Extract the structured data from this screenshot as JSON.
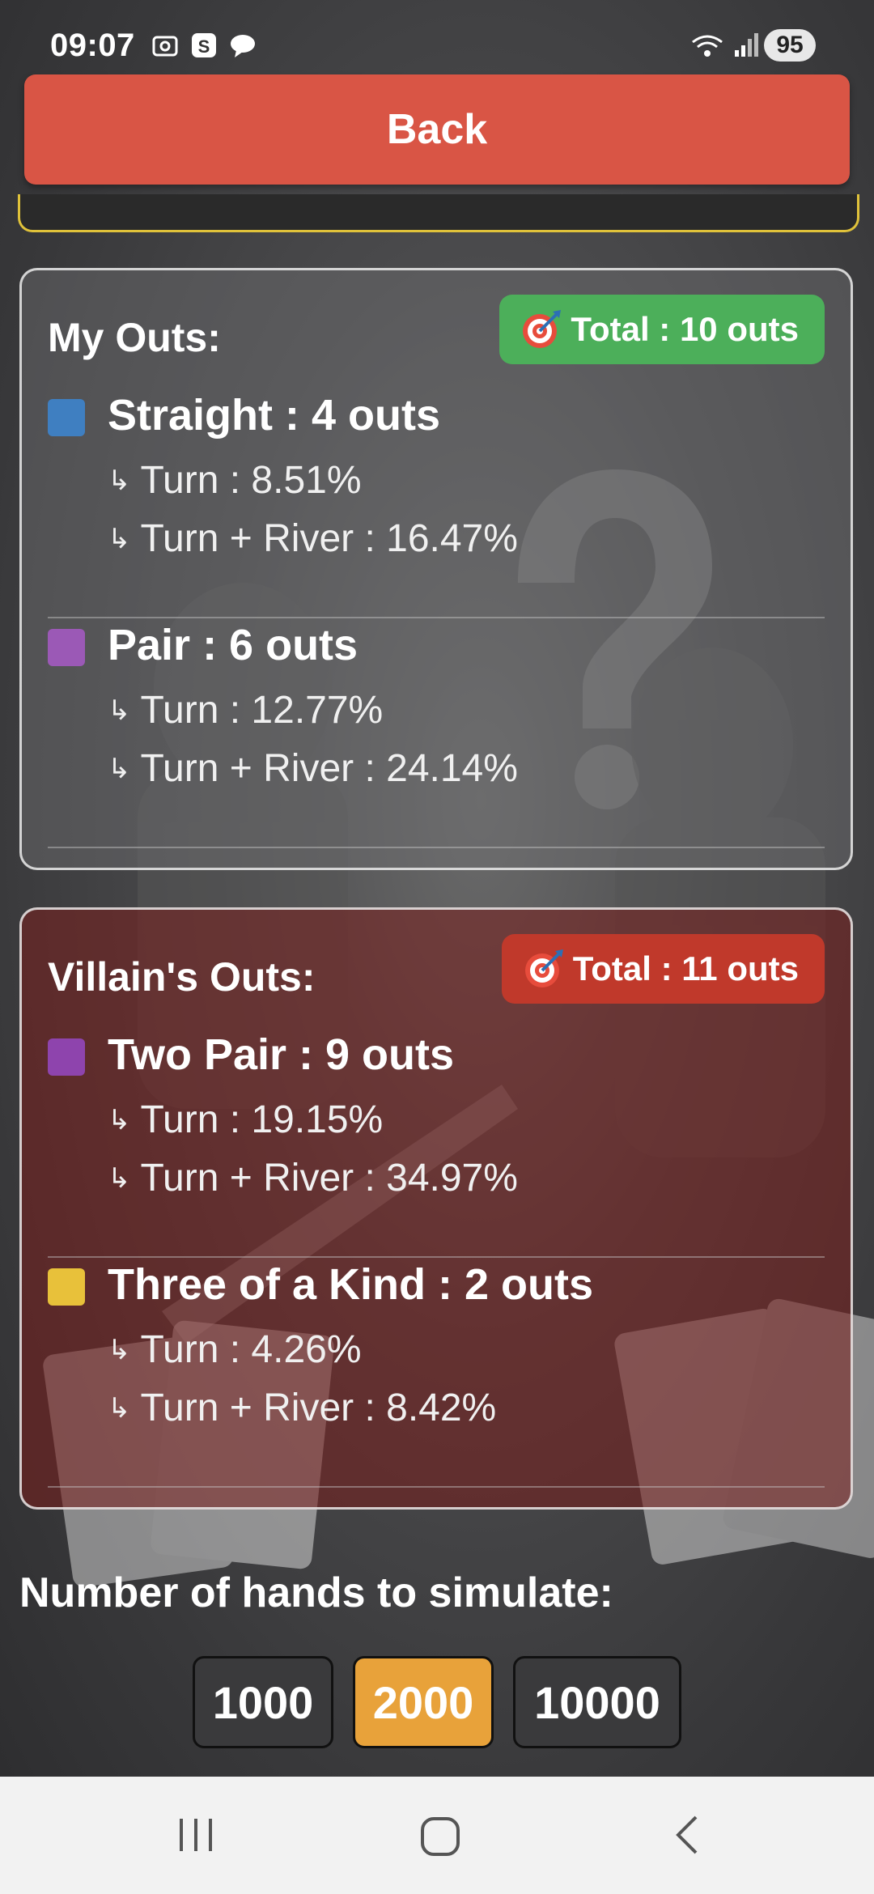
{
  "status_bar": {
    "time": "09:07",
    "battery": "95",
    "icons": [
      "screenshot-icon",
      "s-app-icon",
      "chat-icon",
      "wifi-icon",
      "signal-icon"
    ]
  },
  "back_button": {
    "label": "Back"
  },
  "my_outs": {
    "title": "My Outs:",
    "total": "Total : 10 outs",
    "items": [
      {
        "name": "Straight : 4 outs",
        "color": "#3f7fc1",
        "turn": "Turn : 8.51%",
        "turn_river": "Turn + River : 16.47%"
      },
      {
        "name": "Pair : 6 outs",
        "color": "#9b59b6",
        "turn": "Turn : 12.77%",
        "turn_river": "Turn + River : 24.14%"
      }
    ]
  },
  "villain_outs": {
    "title": "Villain's Outs:",
    "total": "Total : 11 outs",
    "items": [
      {
        "name": "Two Pair : 9 outs",
        "color": "#8e44ad",
        "turn": "Turn : 19.15%",
        "turn_river": "Turn + River : 34.97%"
      },
      {
        "name": "Three of a Kind : 2 outs",
        "color": "#e8c13a",
        "turn": "Turn : 4.26%",
        "turn_river": "Turn + River : 8.42%"
      }
    ]
  },
  "simulation": {
    "label": "Number of hands to simulate:",
    "options": [
      "1000",
      "2000",
      "10000"
    ],
    "selected": "2000"
  },
  "colors": {
    "back": "#d95545",
    "total_mine": "#4caf5a",
    "total_villain": "#c0392b",
    "selected_option": "#e8a23a"
  }
}
